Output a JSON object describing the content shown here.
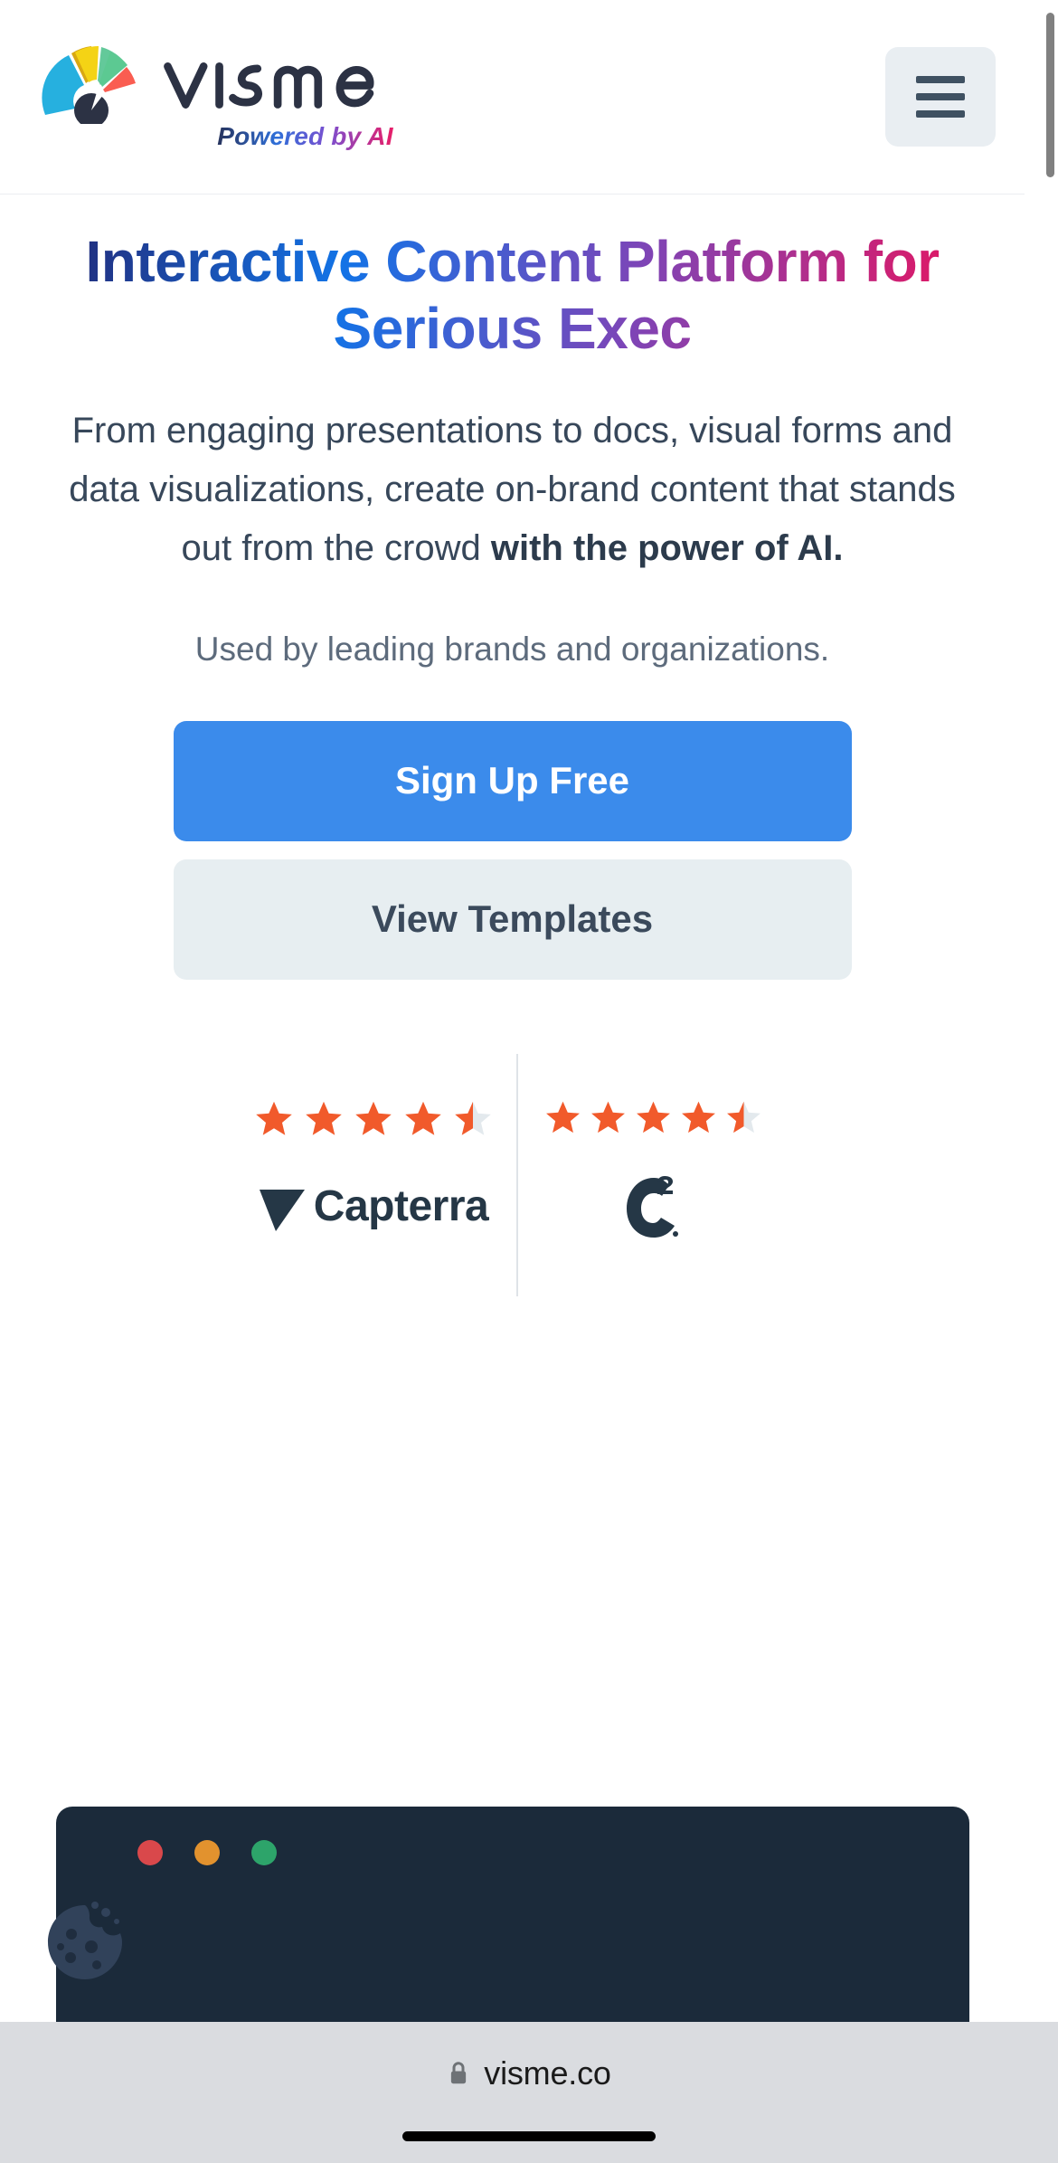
{
  "header": {
    "brand_name": "visme",
    "tagline": "Powered by AI",
    "menu_label": "Open menu",
    "logo_icon": "visme-gauge-logo",
    "menu_icon": "hamburger-menu-icon"
  },
  "hero": {
    "title": "Interactive Content Platform for Serious Exec",
    "subtitle_part1": "From engaging presentations to docs, visual forms and data visualizations, create on-brand content that stands out from the crowd ",
    "subtitle_bold": "with the power of AI.",
    "brands_line": "Used by leading brands and organizations.",
    "primary_cta": "Sign Up Free",
    "secondary_cta": "View Templates"
  },
  "ratings": [
    {
      "source": "Capterra",
      "stars_full": 4,
      "stars_half": 1,
      "rating": "4.5",
      "logo_icon": "capterra-arrow-logo"
    },
    {
      "source": "G2",
      "stars_full": 4,
      "stars_half": 1,
      "rating": "4.5",
      "logo_icon": "g2-logo"
    }
  ],
  "mockup": {
    "window_dots": [
      "red",
      "amber",
      "green"
    ],
    "cookie_icon": "cookie-consent-icon"
  },
  "browser": {
    "url": "visme.co",
    "lock_icon": "padlock-icon",
    "home_indicator": "home-indicator"
  },
  "colors": {
    "primary_button": "#3b8beb",
    "secondary_button": "#e7eef1",
    "star_filled": "#f15a2b",
    "star_empty": "#e3e9ed",
    "mockup_bg": "#1b2a3a",
    "text_dark": "#37475a",
    "browser_bar": "#dadce0",
    "gradient_start": "#24246e",
    "gradient_end": "#ef1158"
  }
}
